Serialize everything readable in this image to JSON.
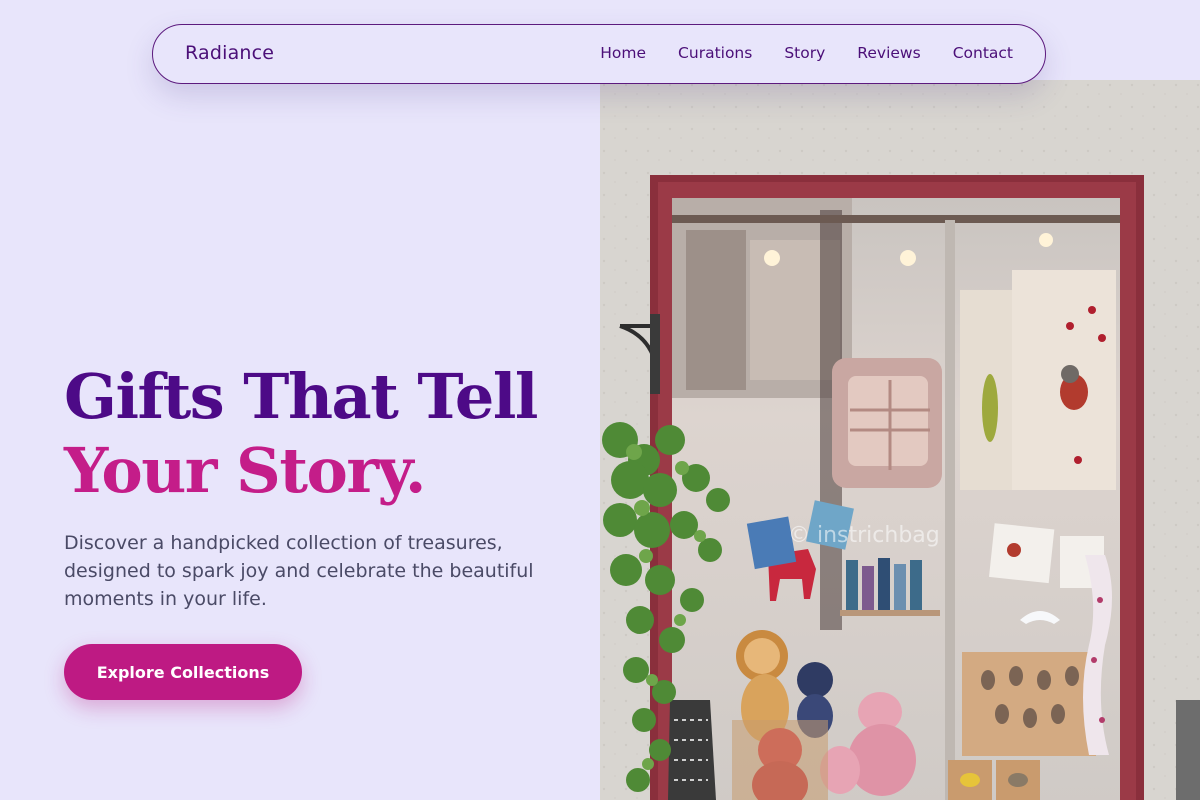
{
  "brand": {
    "name": "Radiance"
  },
  "nav": {
    "links": [
      "Home",
      "Curations",
      "Story",
      "Reviews",
      "Contact"
    ]
  },
  "hero": {
    "title_line1": "Gifts That Tell",
    "title_line2": "Your Story.",
    "description": "Discover a handpicked collection of treasures, designed to spark joy and celebrate the beautiful moments in your life.",
    "cta_label": "Explore Collections",
    "image_alt": "Gift shop storefront window with plush toys, cushions and bird prints",
    "watermark": "© instrichbag"
  },
  "colors": {
    "background": "#e8e5fb",
    "brand_purple": "#4d0a87",
    "accent_magenta": "#c41d89",
    "cta": "#be1a83"
  },
  "icons": {
    "window_frame": "door-frame-icon"
  }
}
